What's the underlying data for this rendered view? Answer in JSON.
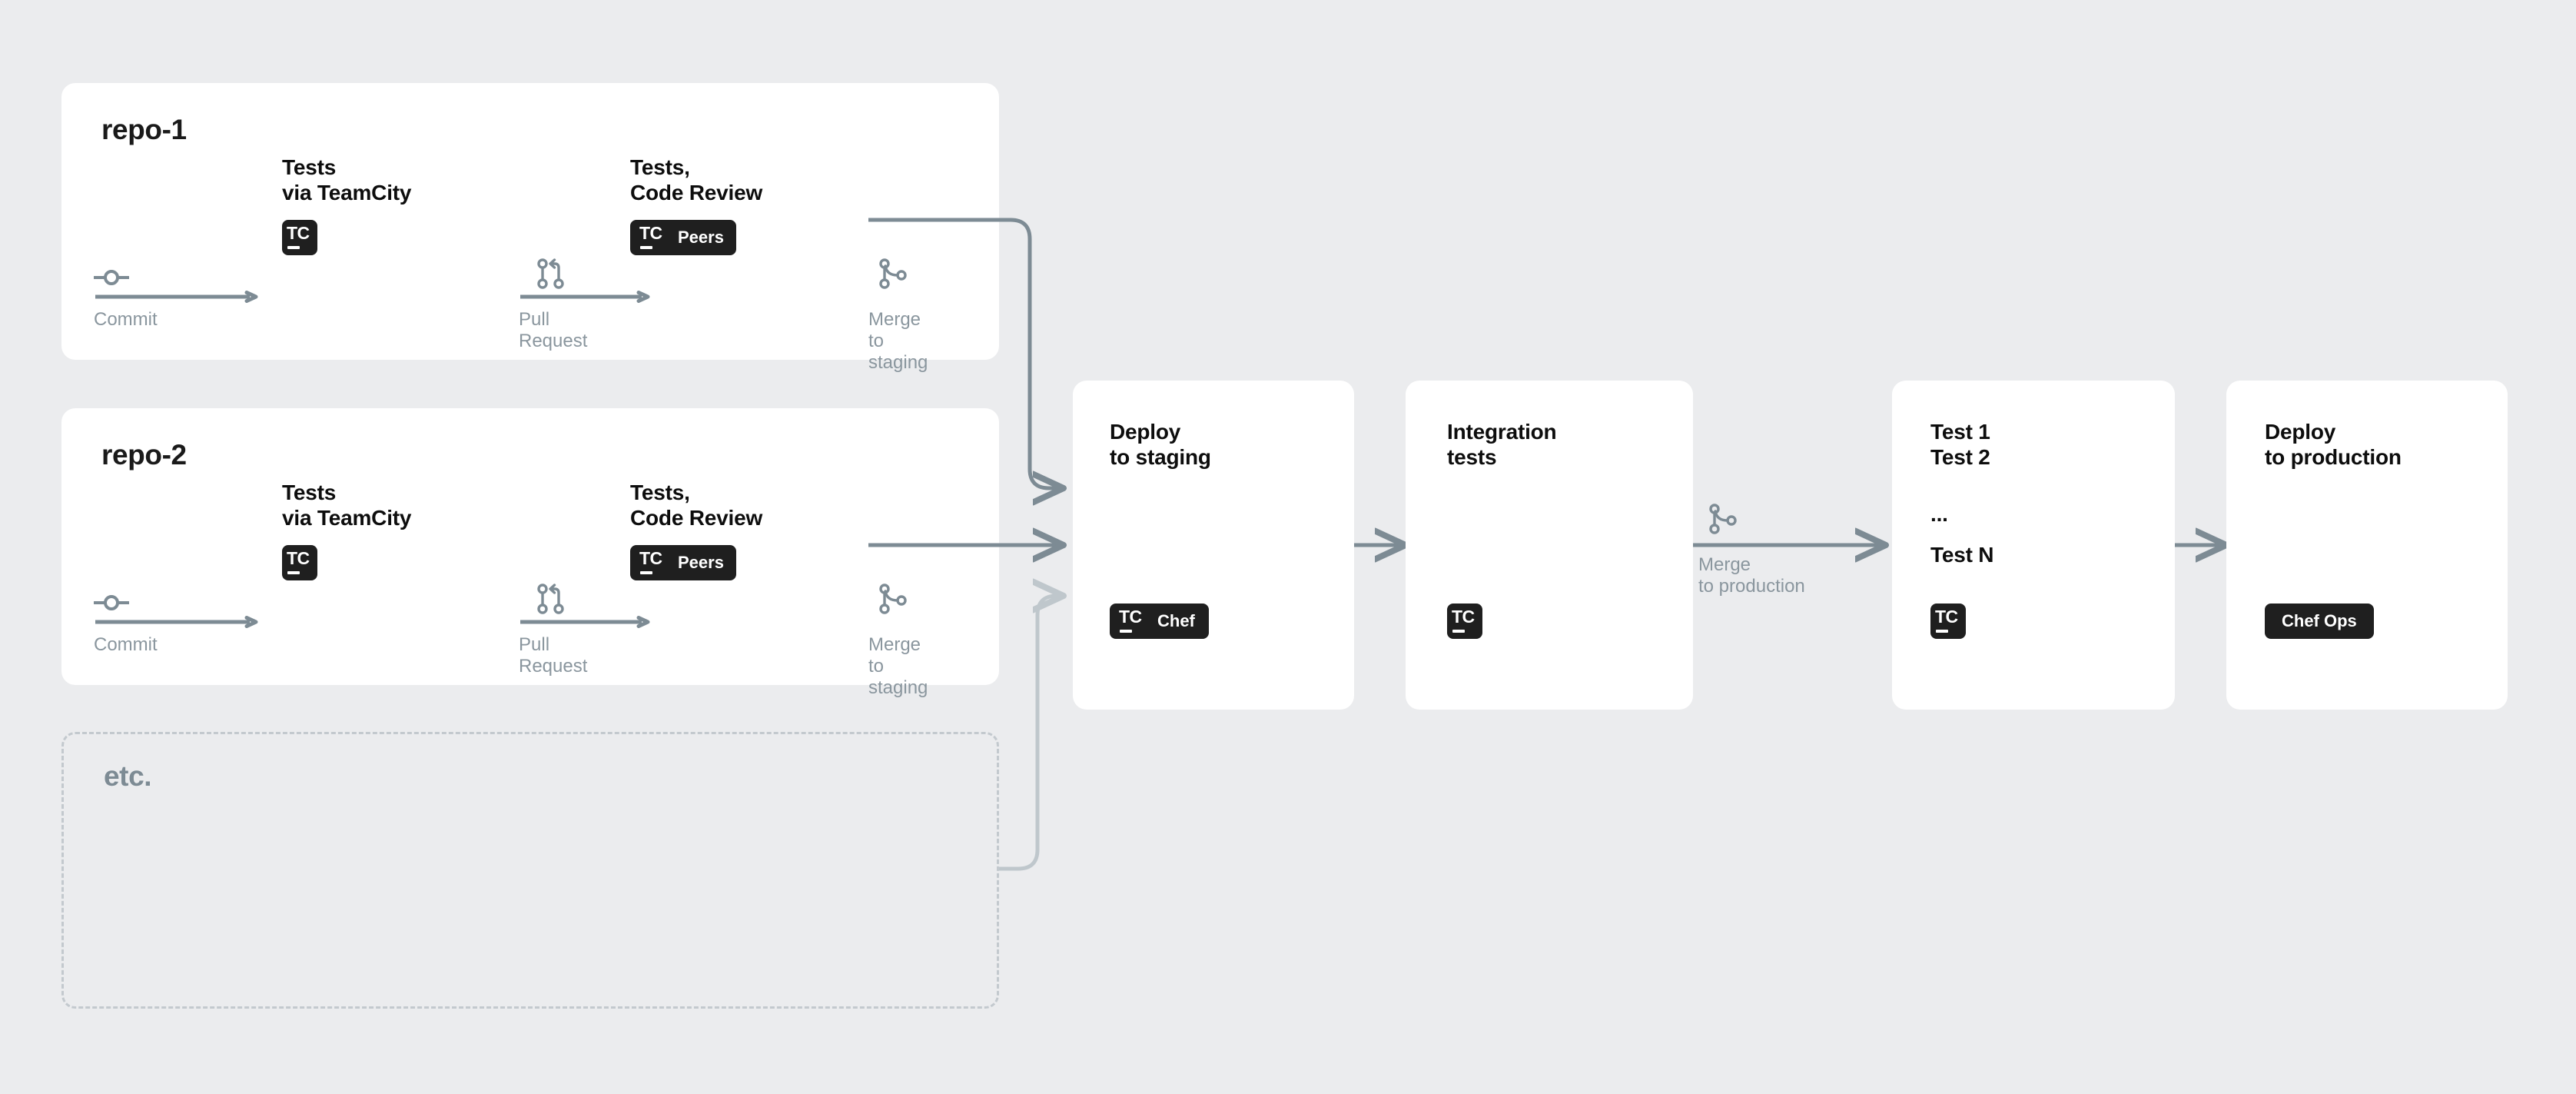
{
  "diagram": {
    "background_color": "#ebecee",
    "card_color": "#ffffff",
    "line_color": "#7d8b94",
    "faded_line_color": "#bfc7cc",
    "badge_color": "#1f1f1f",
    "muted_text_color": "#8a969e"
  },
  "repos": [
    {
      "title": "repo-1",
      "steps": [
        {
          "title": "Tests\nvia TeamCity",
          "badges": [
            {
              "logo": "TC",
              "label": ""
            }
          ]
        },
        {
          "title": "Tests,\nCode Review",
          "badges": [
            {
              "logo": "TC",
              "label": "Peers"
            }
          ]
        }
      ],
      "transitions": [
        {
          "icon": "git-commit-icon",
          "label": "Commit"
        },
        {
          "icon": "git-pull-request-icon",
          "label": "Pull\nRequest"
        },
        {
          "icon": "git-merge-icon",
          "label": "Merge\nto staging"
        }
      ]
    },
    {
      "title": "repo-2",
      "steps": [
        {
          "title": "Tests\nvia TeamCity",
          "badges": [
            {
              "logo": "TC",
              "label": ""
            }
          ]
        },
        {
          "title": "Tests,\nCode Review",
          "badges": [
            {
              "logo": "TC",
              "label": "Peers"
            }
          ]
        }
      ],
      "transitions": [
        {
          "icon": "git-commit-icon",
          "label": "Commit"
        },
        {
          "icon": "git-pull-request-icon",
          "label": "Pull\nRequest"
        },
        {
          "icon": "git-merge-icon",
          "label": "Merge\nto staging"
        }
      ]
    }
  ],
  "etc": {
    "title": "etc."
  },
  "pipeline": [
    {
      "title": "Deploy\nto staging",
      "badge": {
        "logo": "TC",
        "label": "Chef"
      }
    },
    {
      "title": "Integration\ntests",
      "badge": {
        "logo": "TC",
        "label": ""
      }
    },
    {
      "title": "Test 1\nTest 2",
      "ellipsis": "...",
      "subtitle": "Test N",
      "badge": {
        "logo": "TC",
        "label": ""
      }
    },
    {
      "title": "Deploy\nto production",
      "badge": {
        "logo": "",
        "label": "Chef Ops"
      }
    }
  ],
  "pipeline_transitions": [
    {
      "icon": "git-merge-icon",
      "label": "Merge\nto production"
    }
  ]
}
